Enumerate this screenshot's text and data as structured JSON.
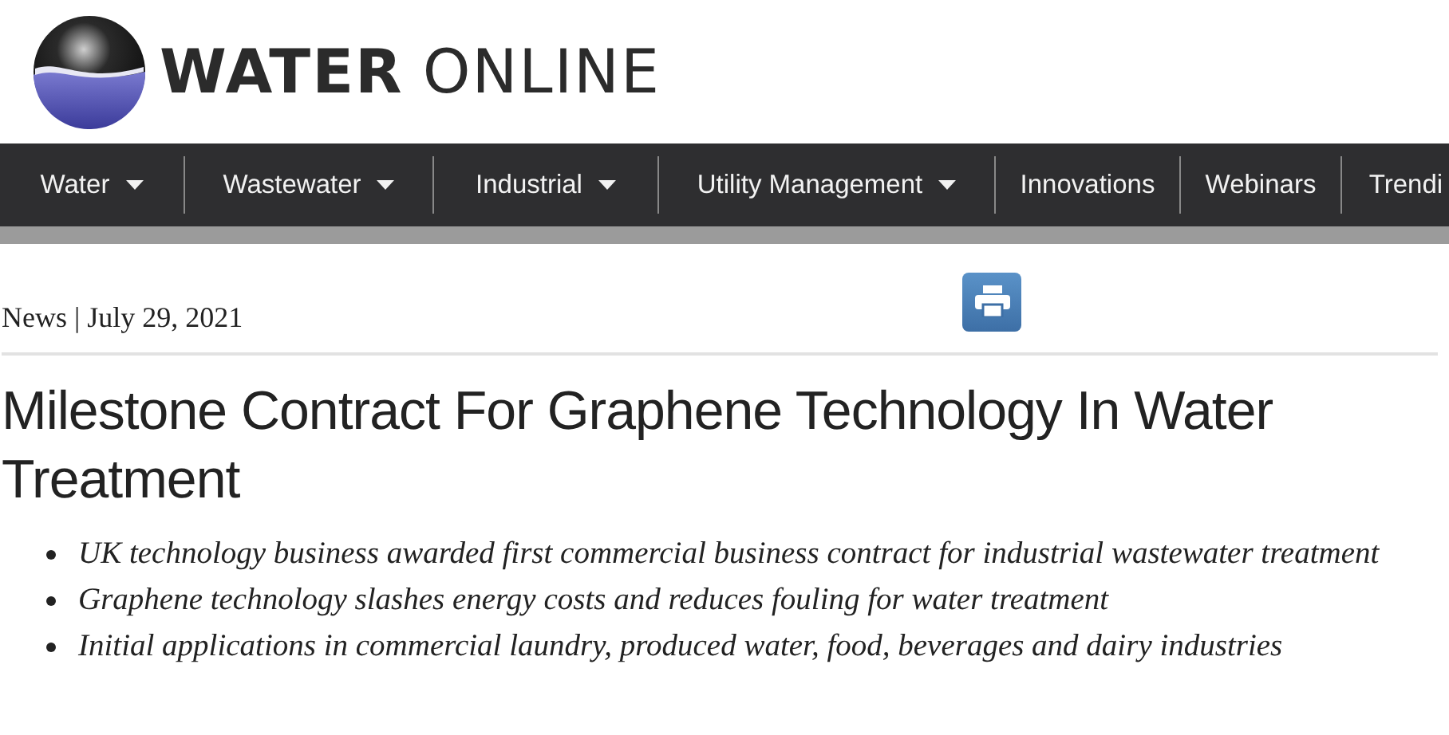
{
  "logo": {
    "bold": "WATER",
    "light": "ONLINE"
  },
  "nav": [
    {
      "label": "Water",
      "dropdown": true
    },
    {
      "label": "Wastewater",
      "dropdown": true
    },
    {
      "label": "Industrial",
      "dropdown": true
    },
    {
      "label": "Utility Management",
      "dropdown": true
    },
    {
      "label": "Innovations",
      "dropdown": false
    },
    {
      "label": "Webinars",
      "dropdown": false
    },
    {
      "label": "Trendi",
      "dropdown": false
    }
  ],
  "article": {
    "category": "News",
    "separator": "|",
    "date": "July 29, 2021",
    "title": "Milestone Contract For Graphene Technology In Water Treatment",
    "highlights": [
      "UK technology business awarded first commercial business contract for industrial wastewater treatment",
      "Graphene technology slashes energy costs and reduces fouling for water treatment",
      "Initial applications in commercial laundry, produced water, food, beverages and dairy industries"
    ]
  }
}
